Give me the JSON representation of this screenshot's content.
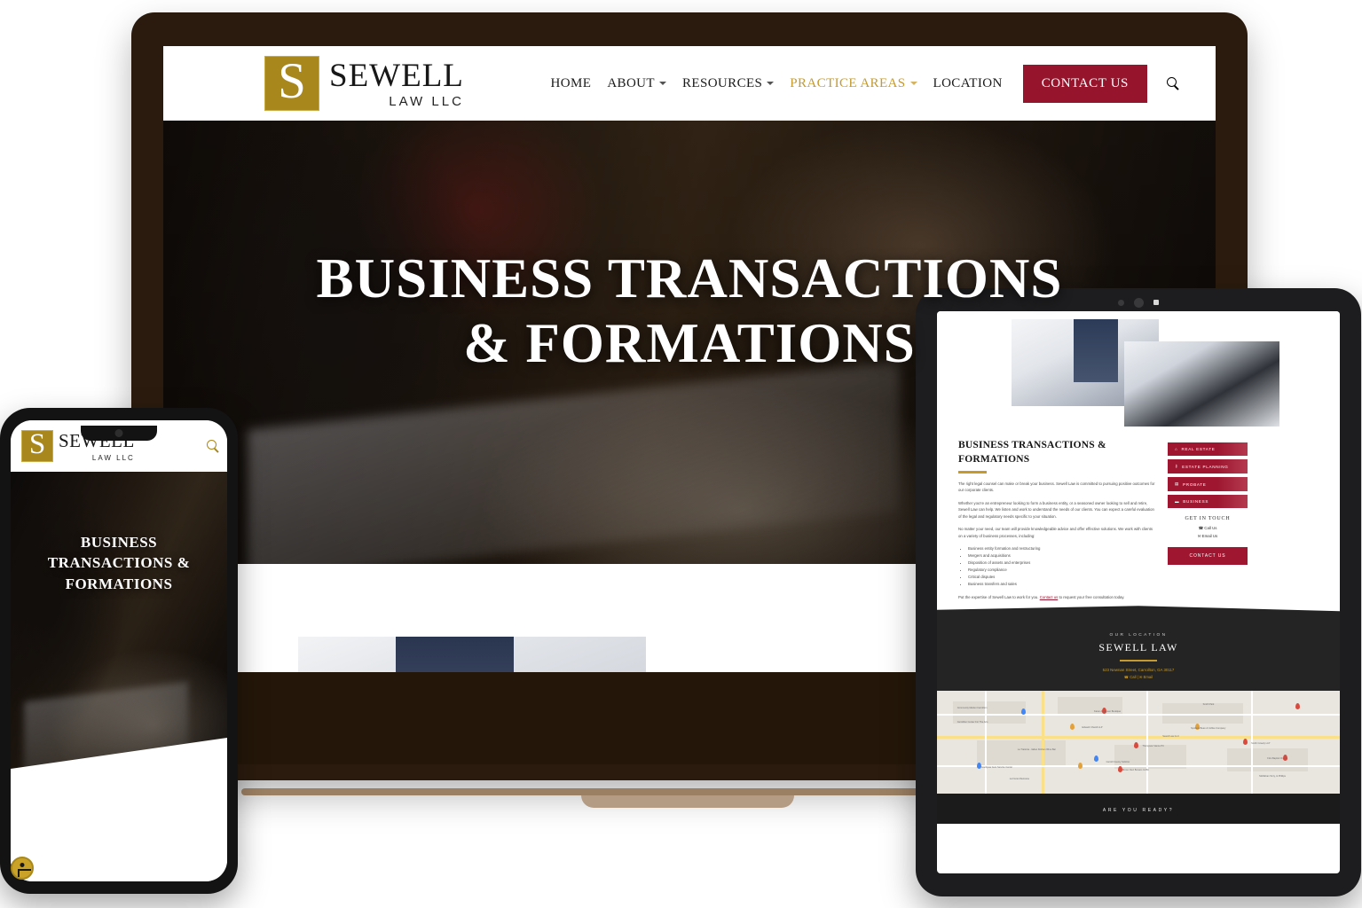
{
  "brand": {
    "logo_letter": "S",
    "name": "SEWELL",
    "subtitle": "LAW  LLC",
    "accent_gold": "#a8881c",
    "accent_red": "#96142c"
  },
  "desktop": {
    "nav": {
      "items": [
        {
          "label": "HOME",
          "has_caret": false,
          "active": false
        },
        {
          "label": "ABOUT",
          "has_caret": true,
          "active": false
        },
        {
          "label": "RESOURCES",
          "has_caret": true,
          "active": false
        },
        {
          "label": "PRACTICE AREAS",
          "has_caret": true,
          "active": true
        },
        {
          "label": "LOCATION",
          "has_caret": false,
          "active": false
        }
      ],
      "cta_label": "CONTACT US",
      "search_icon": "search-icon"
    },
    "hero": {
      "line1": "BUSINESS TRANSACTIONS",
      "line2": "& FORMATIONS"
    }
  },
  "tablet": {
    "heading": "BUSINESS TRANSACTIONS & FORMATIONS",
    "paragraphs": [
      "The right legal counsel can make or break your business. Sewell Law is committed to pursuing positive outcomes for our corporate clients.",
      "Whether you're an entrepreneur looking to form a business entity, or a seasoned owner looking to sell and retire, Sewell Law can help. We listen and work to understand the needs of our clients. You can expect a careful evaluation of the legal and regulatory needs specific to your situation.",
      "No matter your need, our team will provide knowledgeable advice and offer effective solutions. We work with clients on a variety of business processes, including:"
    ],
    "bullets": [
      "Business entity formation and restructuring",
      "Mergers and acquisitions",
      "Disposition of assets and enterprises",
      "Regulatory compliance",
      "Critical disputes",
      "Business transfers and sales"
    ],
    "closing_before": "Put the expertise of Sewell Law to work for you. ",
    "closing_link": "Contact us",
    "closing_after": " to request your free consultation today.",
    "sidebar_buttons": [
      {
        "label": "REAL ESTATE",
        "icon": "home-icon",
        "glyph": "⌂"
      },
      {
        "label": "ESTATE PLANNING",
        "icon": "key-icon",
        "glyph": "⚷"
      },
      {
        "label": "PROBATE",
        "icon": "bank-icon",
        "glyph": "▤"
      },
      {
        "label": "BUSINESS",
        "icon": "briefcase-icon",
        "glyph": "▬"
      }
    ],
    "get_in_touch_title": "GET IN TOUCH",
    "call_label": "Call Us",
    "email_label": "Email Us",
    "contact_button": "CONTACT US",
    "location": {
      "eyebrow": "OUR LOCATION",
      "name": "SEWELL LAW",
      "address": "523 Newnan Street, Carrollton, GA 30117",
      "call_link": "Call",
      "email_link": "Email"
    },
    "map_labels": [
      "Community Market Carrollton",
      "Carrollton Center For The Arts",
      "Karen A. Jansen Boutique",
      "Smith Park",
      "Edward Chandl LLP",
      "Spotless Bean & Coffee Company",
      "Smith Cowely LLP",
      "La Trattoria - Italian Kitchen Wine Bar",
      "Thompson Vance PC",
      "Goodyear Auto Service Center",
      "Carroll County Solicitor",
      "Brown Deci Bowers Griffin",
      "First Baptist Church",
      "McMahan Terry, & Phillips",
      "La Fonte Mexicana",
      "Sewell Law LLC"
    ],
    "footer_cta": "ARE YOU READY?"
  },
  "phone": {
    "search_icon": "search-icon",
    "hero_line1": "BUSINESS",
    "hero_line2": "TRANSACTIONS &",
    "hero_line3": "FORMATIONS",
    "a11y_icon": "accessibility-icon"
  }
}
